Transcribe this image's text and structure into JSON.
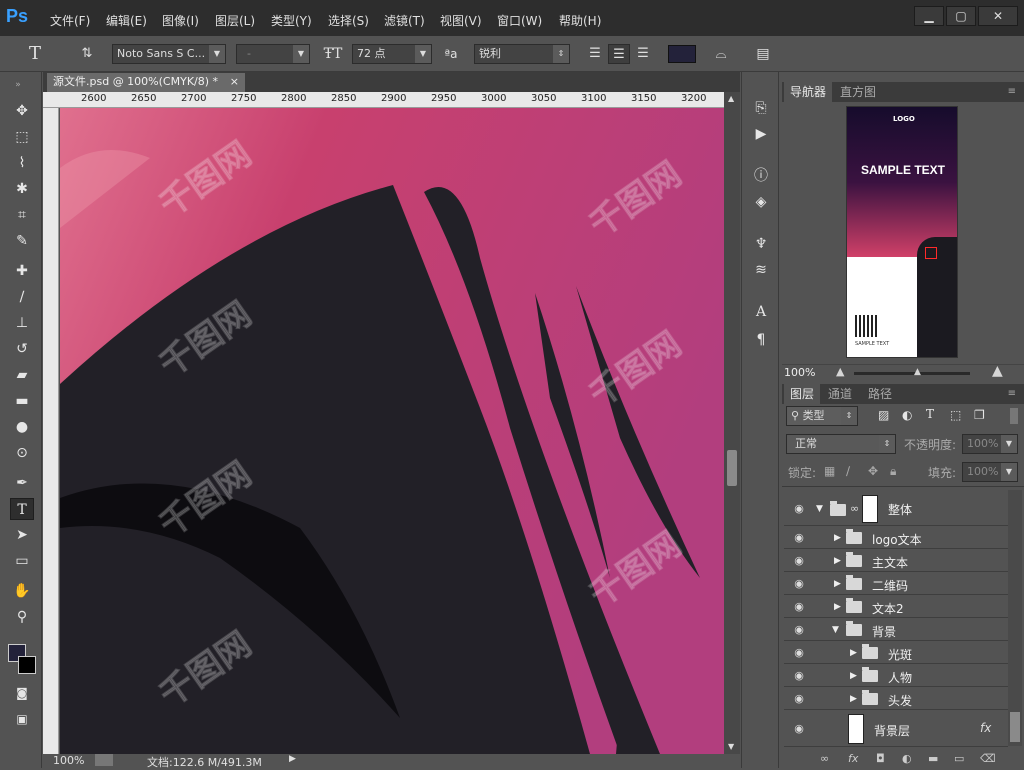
{
  "app": {
    "logo": "Ps",
    "menus": [
      "文件(F)",
      "编辑(E)",
      "图像(I)",
      "图层(L)",
      "类型(Y)",
      "选择(S)",
      "滤镜(T)",
      "视图(V)",
      "窗口(W)",
      "帮助(H)"
    ],
    "window_controls": [
      "▁",
      "▢",
      "✕"
    ]
  },
  "options": {
    "font_family": "Noto Sans S C...",
    "font_style": "-",
    "font_size": "72 点",
    "antialias": "锐利",
    "aa_label": "ªa"
  },
  "document": {
    "tab_title": "源文件.psd @ 100%(CMYK/8) *",
    "ruler_ticks": [
      "2600",
      "2650",
      "2700",
      "2750",
      "2800",
      "2850",
      "2900",
      "2950",
      "3000",
      "3050",
      "3100",
      "3150",
      "3200"
    ],
    "zoom": "100%",
    "doc_size": "文档:122.6 M/491.3M",
    "watermark": "千图网"
  },
  "navigator": {
    "tabs": [
      "导航器",
      "直方图"
    ],
    "zoom": "100%",
    "thumb_logo": "LOGO",
    "thumb_title": "SAMPLE TEXT",
    "thumb_footer": "SAMPLE TEXT"
  },
  "layers": {
    "tabs": [
      "图层",
      "通道",
      "路径"
    ],
    "filter_kind": "类型",
    "blend_mode": "正常",
    "opacity_label": "不透明度:",
    "opacity_value": "100%",
    "lock_label": "锁定:",
    "fill_label": "填充:",
    "fill_value": "100%",
    "items": [
      {
        "name": "整体",
        "expanded": true
      },
      {
        "name": "logo文本",
        "expanded": false
      },
      {
        "name": "主文本",
        "expanded": false
      },
      {
        "name": "二维码",
        "expanded": false
      },
      {
        "name": "文本2",
        "expanded": false
      },
      {
        "name": "背景",
        "expanded": true
      },
      {
        "name": "光斑",
        "expanded": false
      },
      {
        "name": "人物",
        "expanded": false
      },
      {
        "name": "头发",
        "expanded": false
      },
      {
        "name": "背景层",
        "expanded": false
      }
    ],
    "fx_label": "fx"
  },
  "colors": {
    "accent": "#39a0ff",
    "canvas_pink": "#c8406e",
    "silhouette": "#222027"
  }
}
